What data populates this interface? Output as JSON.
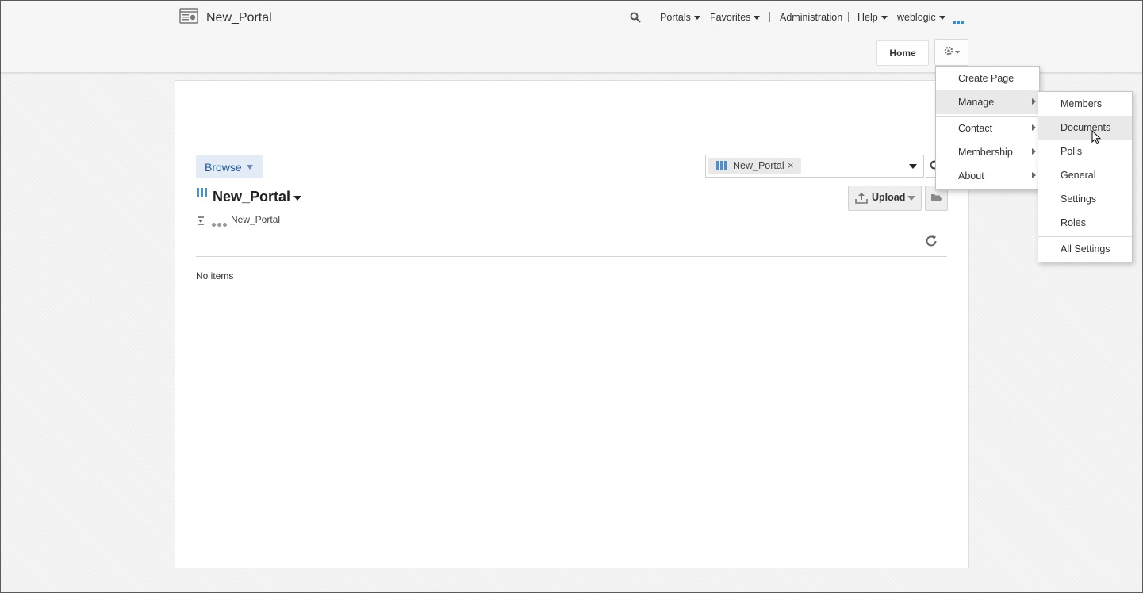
{
  "header": {
    "portal_title": "New_Portal",
    "nav": {
      "portals": "Portals",
      "favorites": "Favorites",
      "administration": "Administration",
      "help": "Help",
      "user": "weblogic"
    },
    "home_button": "Home"
  },
  "browse": {
    "label": "Browse",
    "filter_chip": "New_Portal"
  },
  "folder": {
    "title": "New_Portal",
    "breadcrumb": "New_Portal",
    "upload_label": "Upload",
    "empty_text": "No items"
  },
  "settings_menu": {
    "items": [
      {
        "label": "Create Page"
      },
      {
        "label": "Manage"
      },
      {
        "label": "Contact"
      },
      {
        "label": "Membership"
      },
      {
        "label": "About"
      }
    ]
  },
  "manage_submenu": {
    "items": [
      {
        "label": "Members"
      },
      {
        "label": "Documents"
      },
      {
        "label": "Polls"
      },
      {
        "label": "General"
      },
      {
        "label": "Settings"
      },
      {
        "label": "Roles"
      },
      {
        "label": "All Settings"
      }
    ]
  },
  "colors": {
    "accent_blue": "#3b87d8",
    "browse_bg": "#e3ecf6",
    "browse_text": "#1f5a95",
    "menu_highlight": "#e9e9e9"
  }
}
